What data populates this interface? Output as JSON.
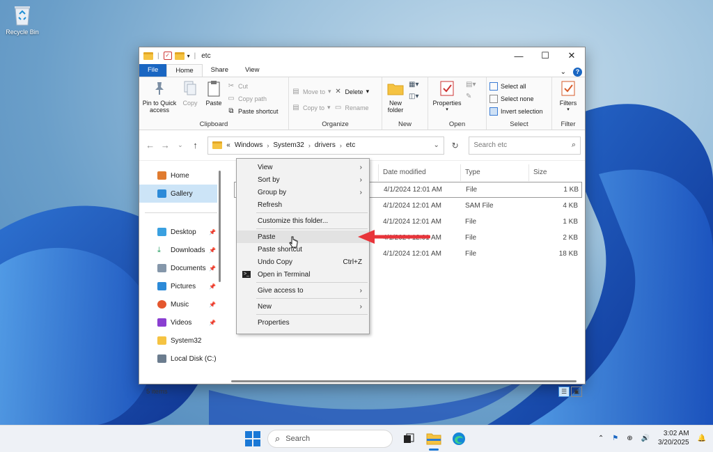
{
  "desktop": {
    "recycle_bin": "Recycle Bin"
  },
  "window": {
    "title": "etc",
    "tabs": {
      "file": "File",
      "home": "Home",
      "share": "Share",
      "view": "View"
    },
    "ribbon": {
      "clipboard": {
        "label": "Clipboard",
        "pin": "Pin to Quick access",
        "copy": "Copy",
        "paste": "Paste",
        "cut": "Cut",
        "copy_path": "Copy path",
        "paste_shortcut": "Paste shortcut"
      },
      "organize": {
        "label": "Organize",
        "move_to": "Move to",
        "copy_to": "Copy to",
        "delete": "Delete",
        "rename": "Rename"
      },
      "new": {
        "label": "New",
        "new_folder": "New folder"
      },
      "open": {
        "label": "Open",
        "properties": "Properties"
      },
      "select": {
        "label": "Select",
        "select_all": "Select all",
        "select_none": "Select none",
        "invert": "Invert selection"
      },
      "filter": {
        "label": "Filter",
        "filters": "Filters"
      }
    },
    "address": {
      "crumbs": [
        "Windows",
        "System32",
        "drivers",
        "etc"
      ],
      "overflow": "«",
      "search_placeholder": "Search etc"
    },
    "nav": {
      "home": "Home",
      "gallery": "Gallery",
      "desktop": "Desktop",
      "downloads": "Downloads",
      "documents": "Documents",
      "pictures": "Pictures",
      "music": "Music",
      "videos": "Videos",
      "system32": "System32",
      "local_disk": "Local Disk (C:)"
    },
    "columns": {
      "date": "Date modified",
      "type": "Type",
      "size": "Size"
    },
    "rows": [
      {
        "date": "4/1/2024 12:01 AM",
        "type": "File",
        "size": "1 KB"
      },
      {
        "date": "4/1/2024 12:01 AM",
        "type": "SAM File",
        "size": "4 KB"
      },
      {
        "date": "4/1/2024 12:01 AM",
        "type": "File",
        "size": "1 KB"
      },
      {
        "date": "4/1/2024 12:01 AM",
        "type": "File",
        "size": "2 KB"
      },
      {
        "date": "4/1/2024 12:01 AM",
        "type": "File",
        "size": "18 KB"
      }
    ],
    "status": "5 items"
  },
  "context_menu": {
    "view": "View",
    "sort_by": "Sort by",
    "group_by": "Group by",
    "refresh": "Refresh",
    "customize": "Customize this folder...",
    "paste": "Paste",
    "paste_shortcut": "Paste shortcut",
    "undo_copy": "Undo Copy",
    "undo_copy_accel": "Ctrl+Z",
    "open_terminal": "Open in Terminal",
    "give_access": "Give access to",
    "new": "New",
    "properties": "Properties"
  },
  "taskbar": {
    "search": "Search",
    "time": "3:02 AM",
    "date": "3/20/2025"
  },
  "colors": {
    "accent": "#1a66c2",
    "arrow": "#e8343a",
    "selection": "#cce4f7"
  }
}
